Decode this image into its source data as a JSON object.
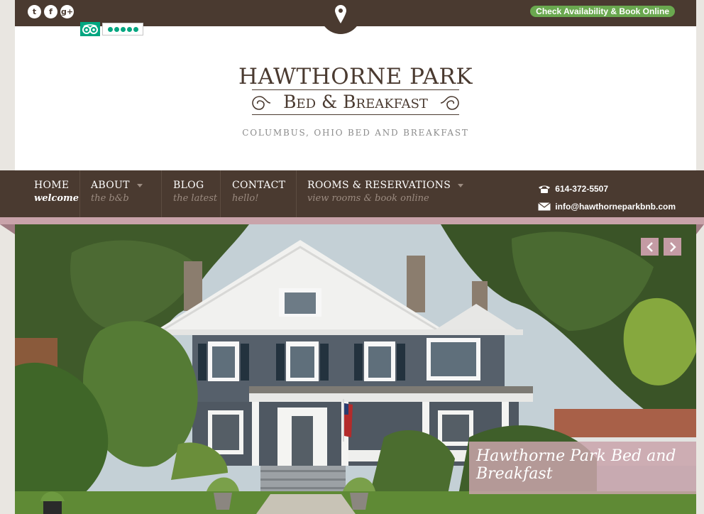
{
  "topbar": {
    "social_icons": [
      "twitter-icon",
      "facebook-icon",
      "google-plus-icon"
    ],
    "book_label": "Check Availability & Book Online",
    "location_icon": "map-pin-icon",
    "tripadvisor": {
      "icon": "tripadvisor-owl-icon",
      "rating_bubbles": 5
    }
  },
  "logo": {
    "title": "HAWTHORNE PARK",
    "subtitle": "Bed & Breakfast",
    "tagline": "COLUMBUS, OHIO BED AND BREAKFAST"
  },
  "nav": {
    "items": [
      {
        "label": "HOME",
        "sub": "welcome",
        "dropdown": false
      },
      {
        "label": "ABOUT",
        "sub": "the b&b",
        "dropdown": true
      },
      {
        "label": "BLOG",
        "sub": "the latest",
        "dropdown": false
      },
      {
        "label": "CONTACT",
        "sub": "hello!",
        "dropdown": false
      },
      {
        "label": "ROOMS & RESERVATIONS",
        "sub": "view rooms & book online",
        "dropdown": true
      }
    ],
    "phone": "614-372-5507",
    "email": "info@hawthorneparkbnb.com"
  },
  "hero": {
    "caption": "Hawthorne Park Bed and Breakfast",
    "prev_icon": "chevron-left-icon",
    "next_icon": "chevron-right-icon"
  },
  "colors": {
    "brand_brown": "#4a3a30",
    "accent_pink": "#c9a3aa",
    "book_green": "#6aa84f",
    "tripadvisor_green": "#00a680"
  }
}
